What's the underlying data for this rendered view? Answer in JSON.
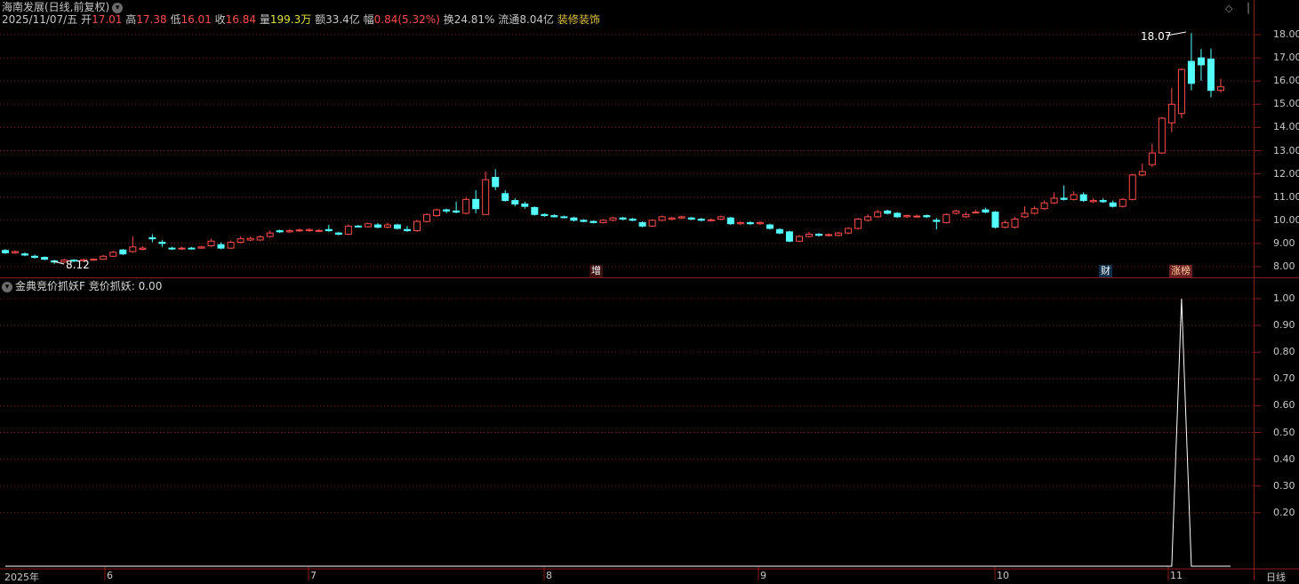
{
  "header": {
    "title": "海南发展(日线,前复权)",
    "date": "2025/11/07/五",
    "open_label": "开",
    "open": "17.01",
    "high_label": "高",
    "high": "17.38",
    "low_label": "低",
    "low": "16.01",
    "close_label": "收",
    "close": "16.84",
    "volume_label": "量",
    "volume": "199.3万",
    "amount_label": "额",
    "amount": "33.4亿",
    "change_label": "幅",
    "change": "0.84(5.32%)",
    "turnover_label": "换",
    "turnover": "24.81%",
    "float_label": "流通",
    "float": "8.04亿",
    "tag": "装修装饰"
  },
  "colors": {
    "up": "#ff4d4d",
    "down": "#54ffff",
    "grid": "#8b1a1a",
    "tag": "#e0c040",
    "volume": "#e0e040"
  },
  "price_axis": [
    "18.00",
    "17.00",
    "16.00",
    "15.00",
    "14.00",
    "13.00",
    "12.00",
    "11.00",
    "10.00",
    "9.00",
    "8.00"
  ],
  "indicator_axis": [
    "1.00",
    "0.90",
    "0.80",
    "0.70",
    "0.60",
    "0.50",
    "0.40",
    "0.30",
    "0.20"
  ],
  "x_axis": [
    "2025年",
    "6",
    "7",
    "8",
    "9",
    "10",
    "11"
  ],
  "x_axis_corner": "日线",
  "annotations": {
    "max": "18.07",
    "min": "8.12"
  },
  "badges": [
    "增",
    "财",
    "涨榜"
  ],
  "indicator": {
    "name": "金典竞价抓妖F",
    "series_label": "竞价抓妖:",
    "value": "0.00"
  },
  "chart_data": {
    "type": "candlestick",
    "ylim": [
      7.7,
      18.2
    ],
    "candles": [
      [
        8.7,
        8.6,
        8.75,
        8.55
      ],
      [
        8.6,
        8.65,
        8.7,
        8.55
      ],
      [
        8.55,
        8.5,
        8.62,
        8.45
      ],
      [
        8.45,
        8.4,
        8.52,
        8.35
      ],
      [
        8.4,
        8.32,
        8.45,
        8.28
      ],
      [
        8.25,
        8.2,
        8.3,
        8.12
      ],
      [
        8.2,
        8.28,
        8.34,
        8.16
      ],
      [
        8.28,
        8.25,
        8.32,
        8.2
      ],
      [
        8.25,
        8.3,
        8.35,
        8.22
      ],
      [
        8.3,
        8.32,
        8.36,
        8.26
      ],
      [
        8.32,
        8.45,
        8.5,
        8.3
      ],
      [
        8.45,
        8.62,
        8.68,
        8.42
      ],
      [
        8.72,
        8.55,
        8.76,
        8.5
      ],
      [
        8.65,
        8.85,
        9.3,
        8.6
      ],
      [
        8.75,
        8.8,
        8.88,
        8.7
      ],
      [
        9.25,
        9.2,
        9.4,
        9.05
      ],
      [
        9.05,
        9.0,
        9.15,
        8.85
      ],
      [
        8.8,
        8.78,
        8.86,
        8.72
      ],
      [
        8.78,
        8.8,
        8.86,
        8.72
      ],
      [
        8.8,
        8.78,
        8.85,
        8.74
      ],
      [
        8.8,
        8.85,
        8.9,
        8.76
      ],
      [
        8.9,
        9.1,
        9.2,
        8.85
      ],
      [
        8.95,
        8.8,
        9.05,
        8.75
      ],
      [
        8.8,
        9.05,
        9.12,
        8.76
      ],
      [
        9.05,
        9.2,
        9.3,
        9.0
      ],
      [
        9.15,
        9.22,
        9.3,
        9.1
      ],
      [
        9.15,
        9.28,
        9.35,
        9.1
      ],
      [
        9.3,
        9.45,
        9.55,
        9.25
      ],
      [
        9.55,
        9.5,
        9.6,
        9.45
      ],
      [
        9.5,
        9.55,
        9.62,
        9.46
      ],
      [
        9.55,
        9.58,
        9.64,
        9.5
      ],
      [
        9.55,
        9.6,
        9.65,
        9.5
      ],
      [
        9.55,
        9.56,
        9.62,
        9.5
      ],
      [
        9.6,
        9.55,
        9.8,
        9.5
      ],
      [
        9.45,
        9.4,
        9.5,
        9.35
      ],
      [
        9.4,
        9.75,
        9.82,
        9.36
      ],
      [
        9.75,
        9.72,
        9.8,
        9.68
      ],
      [
        9.72,
        9.85,
        9.9,
        9.68
      ],
      [
        9.8,
        9.7,
        9.88,
        9.65
      ],
      [
        9.7,
        9.8,
        9.9,
        9.65
      ],
      [
        9.8,
        9.65,
        9.85,
        9.6
      ],
      [
        9.6,
        9.55,
        9.75,
        9.5
      ],
      [
        9.55,
        9.95,
        10.02,
        9.5
      ],
      [
        9.95,
        10.25,
        10.3,
        9.9
      ],
      [
        10.2,
        10.45,
        10.5,
        10.15
      ],
      [
        10.45,
        10.4,
        10.5,
        10.3
      ],
      [
        10.4,
        10.35,
        10.8,
        10.3
      ],
      [
        10.3,
        10.9,
        11.0,
        10.25
      ],
      [
        10.9,
        10.5,
        11.3,
        10.3
      ],
      [
        10.25,
        11.75,
        12.1,
        10.25
      ],
      [
        11.85,
        11.45,
        12.2,
        11.3
      ],
      [
        11.15,
        10.85,
        11.3,
        10.8
      ],
      [
        10.85,
        10.7,
        10.95,
        10.6
      ],
      [
        10.7,
        10.6,
        10.8,
        10.5
      ],
      [
        10.55,
        10.25,
        10.6,
        10.2
      ],
      [
        10.25,
        10.2,
        10.3,
        10.15
      ],
      [
        10.2,
        10.15,
        10.26,
        10.12
      ],
      [
        10.15,
        10.12,
        10.2,
        10.08
      ],
      [
        10.1,
        10.0,
        10.15,
        9.95
      ],
      [
        10.0,
        9.95,
        10.05,
        9.92
      ],
      [
        9.95,
        9.9,
        10.0,
        9.86
      ],
      [
        9.9,
        10.0,
        10.05,
        9.86
      ],
      [
        10.0,
        10.1,
        10.15,
        9.96
      ],
      [
        10.1,
        10.05,
        10.15,
        10.0
      ],
      [
        10.05,
        10.0,
        10.1,
        9.96
      ],
      [
        9.9,
        9.75,
        9.95,
        9.7
      ],
      [
        9.75,
        10.0,
        10.05,
        9.72
      ],
      [
        10.0,
        10.15,
        10.2,
        9.96
      ],
      [
        10.05,
        10.1,
        10.15,
        10.0
      ],
      [
        10.1,
        10.15,
        10.2,
        10.05
      ],
      [
        10.1,
        10.05,
        10.15,
        10.0
      ],
      [
        10.05,
        10.0,
        10.1,
        9.96
      ],
      [
        10.0,
        10.02,
        10.08,
        9.96
      ],
      [
        10.05,
        10.15,
        10.2,
        10.0
      ],
      [
        10.1,
        9.85,
        10.15,
        9.8
      ],
      [
        9.85,
        9.9,
        9.95,
        9.8
      ],
      [
        9.9,
        9.85,
        9.95,
        9.8
      ],
      [
        9.85,
        9.9,
        9.96,
        9.8
      ],
      [
        9.8,
        9.65,
        9.85,
        9.6
      ],
      [
        9.6,
        9.45,
        9.65,
        9.4
      ],
      [
        9.5,
        9.1,
        9.55,
        9.05
      ],
      [
        9.1,
        9.3,
        9.36,
        9.06
      ],
      [
        9.3,
        9.4,
        9.5,
        9.25
      ],
      [
        9.4,
        9.35,
        9.45,
        9.3
      ],
      [
        9.35,
        9.38,
        9.44,
        9.3
      ],
      [
        9.35,
        9.45,
        9.5,
        9.3
      ],
      [
        9.45,
        9.65,
        9.7,
        9.4
      ],
      [
        9.65,
        10.05,
        10.1,
        9.6
      ],
      [
        10.0,
        10.15,
        10.25,
        9.95
      ],
      [
        10.15,
        10.35,
        10.45,
        10.1
      ],
      [
        10.4,
        10.3,
        10.45,
        10.25
      ],
      [
        10.3,
        10.15,
        10.35,
        10.1
      ],
      [
        10.15,
        10.2,
        10.25,
        10.1
      ],
      [
        10.15,
        10.18,
        10.24,
        10.1
      ],
      [
        10.2,
        10.15,
        10.25,
        10.1
      ],
      [
        10.0,
        9.95,
        10.1,
        9.6
      ],
      [
        9.9,
        10.25,
        10.3,
        9.85
      ],
      [
        10.3,
        10.4,
        10.45,
        10.25
      ],
      [
        10.15,
        10.25,
        10.35,
        10.1
      ],
      [
        10.35,
        10.35,
        10.45,
        10.3
      ],
      [
        10.45,
        10.35,
        10.55,
        10.3
      ],
      [
        10.35,
        9.7,
        10.4,
        9.65
      ],
      [
        9.7,
        9.9,
        10.0,
        9.65
      ],
      [
        9.7,
        10.05,
        10.15,
        9.65
      ],
      [
        10.15,
        10.3,
        10.6,
        10.1
      ],
      [
        10.3,
        10.5,
        10.6,
        10.25
      ],
      [
        10.5,
        10.75,
        10.85,
        10.45
      ],
      [
        10.75,
        10.95,
        11.2,
        10.7
      ],
      [
        10.95,
        10.9,
        11.5,
        10.85
      ],
      [
        10.9,
        11.1,
        11.25,
        10.85
      ],
      [
        11.1,
        10.85,
        11.2,
        10.8
      ],
      [
        10.8,
        10.85,
        10.95,
        10.75
      ],
      [
        10.85,
        10.8,
        10.95,
        10.75
      ],
      [
        10.75,
        10.6,
        10.85,
        10.55
      ],
      [
        10.6,
        10.9,
        10.95,
        10.55
      ],
      [
        10.9,
        11.95,
        12.0,
        10.85
      ],
      [
        11.95,
        12.1,
        12.45,
        11.9
      ],
      [
        12.4,
        12.9,
        13.3,
        12.3
      ],
      [
        12.9,
        14.4,
        14.45,
        12.85
      ],
      [
        14.2,
        15.0,
        15.7,
        13.8
      ],
      [
        14.6,
        16.5,
        16.55,
        14.4
      ],
      [
        16.85,
        15.9,
        18.07,
        15.6
      ],
      [
        17.0,
        16.7,
        17.38,
        16.01
      ],
      [
        16.95,
        15.6,
        17.4,
        15.3
      ],
      [
        15.6,
        15.75,
        16.1,
        15.5
      ]
    ],
    "indicator_values": [
      0,
      0,
      0,
      0,
      0,
      0,
      0,
      0,
      0,
      0,
      0,
      0,
      0,
      0,
      0,
      0,
      0,
      0,
      0,
      0,
      0,
      0,
      0,
      0,
      0,
      0,
      0,
      0,
      0,
      0,
      0,
      0,
      0,
      0,
      0,
      0,
      0,
      0,
      0,
      0,
      0,
      0,
      0,
      0,
      0,
      0,
      0,
      0,
      0,
      0,
      0,
      0,
      0,
      0,
      0,
      0,
      0,
      0,
      0,
      0,
      0,
      0,
      0,
      0,
      0,
      0,
      0,
      0,
      0,
      0,
      0,
      0,
      0,
      0,
      0,
      0,
      0,
      0,
      0,
      0,
      0,
      0,
      0,
      0,
      0,
      0,
      0,
      0,
      0,
      0,
      0,
      0,
      0,
      0,
      0,
      0,
      0,
      0,
      0,
      0,
      0,
      0,
      0,
      0,
      0,
      0,
      0,
      0,
      0,
      0,
      0,
      0,
      0,
      0,
      0,
      0,
      0,
      0,
      0,
      0,
      1,
      0,
      0,
      0,
      0,
      0
    ],
    "indicator_ylim": [
      0,
      1.0
    ]
  }
}
